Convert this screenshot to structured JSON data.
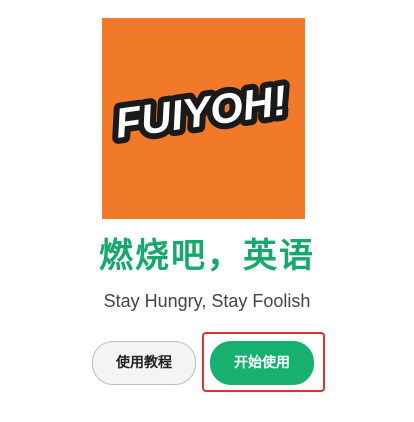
{
  "logo": {
    "text": "FUIYOH!",
    "background_color": "#f07a2a"
  },
  "headline": "燃烧吧，英语",
  "subtitle": "Stay Hungry, Stay Foolish",
  "buttons": {
    "tutorial_label": "使用教程",
    "start_label": "开始使用"
  },
  "colors": {
    "accent": "#17b06f",
    "headline": "#17a86b",
    "highlight": "#e03131"
  }
}
